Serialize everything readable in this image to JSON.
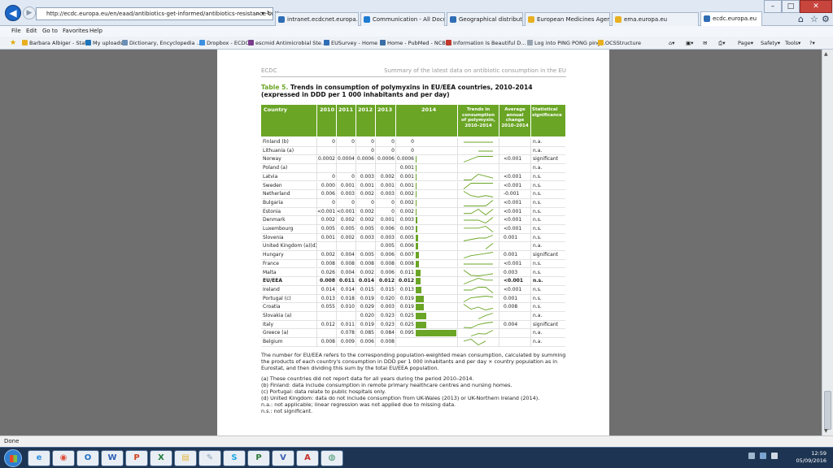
{
  "browser": {
    "address": "http://ecdc.europa.eu/en/eaad/antibiotics-get-informed/antibiotics-resistance-consum",
    "address_domain": "ecdc.europa.eu",
    "tabs": [
      {
        "label": "intranet.ecdcnet.europa.eu",
        "color": "#2f6db5"
      },
      {
        "label": "Communication - All Docum...",
        "color": "#1d7bd1"
      },
      {
        "label": "Geographical distribution of a...",
        "color": "#2f6db5"
      },
      {
        "label": "European Medicines Agency ...",
        "color": "#e8b020"
      },
      {
        "label": "ema.europa.eu",
        "color": "#e8b020"
      },
      {
        "label": "ecdc.europa.eu",
        "color": "#2f6db5"
      }
    ],
    "menu": [
      "File",
      "Edit",
      "Go to",
      "Favorites",
      "Help"
    ],
    "favorites": [
      "Barbara Albiger - Stats",
      "My uploads",
      "Dictionary, Encyclopedia ...",
      "Dropbox - ECDC",
      "escmid Antimicrobial Ste...",
      "EUSurvey - Home",
      "Home - PubMed - NCBI",
      "Information Is Beautiful D...",
      "Log into PING PONG ping...",
      "OCSStructure"
    ],
    "command_items": [
      "Page",
      "Safety",
      "Tools"
    ],
    "status": "Done"
  },
  "document": {
    "running_head_left": "ECDC",
    "running_head_right": "Summary of the latest data on antibiotic consumption in the EU",
    "table_label": "Table 5.",
    "table_title": "Trends in consumption of polymyxins in EU/EEA countries, 2010–2014 (expressed in DDD per 1 000 inhabitants and per day)",
    "headers": {
      "country": "Country",
      "y2010": "2010",
      "y2011": "2011",
      "y2012": "2012",
      "y2013": "2013",
      "y2014": "2014",
      "trends": "Trends in consumption of polymyxin, 2010–2014",
      "avg": "Average annual change 2010–2014",
      "stat": "Statistical significance"
    },
    "bar_max": 0.095,
    "rows": [
      {
        "country": "Finland (b)",
        "v": [
          "0",
          "0",
          "0",
          "0",
          "0"
        ],
        "val2014": 0,
        "series": [
          0,
          0,
          0,
          0,
          0
        ],
        "avg": "",
        "sig": "n.a.",
        "bold": false
      },
      {
        "country": "Lithuania (a)",
        "v": [
          "",
          "",
          "0",
          "0",
          "0"
        ],
        "val2014": 0,
        "series": [
          null,
          null,
          0,
          0,
          0
        ],
        "avg": "",
        "sig": "n.a.",
        "bold": false
      },
      {
        "country": "Norway",
        "v": [
          "0.0002",
          "0.0004",
          "0.0006",
          "0.0006",
          "0.0006"
        ],
        "val2014": 0.0006,
        "series": [
          0.0002,
          0.0004,
          0.0006,
          0.0006,
          0.0006
        ],
        "avg": "<0.001",
        "sig": "significant",
        "bold": false
      },
      {
        "country": "Poland (a)",
        "v": [
          "",
          "",
          "",
          "",
          "0.001"
        ],
        "val2014": 0.001,
        "series": [
          null,
          null,
          null,
          null,
          0.001
        ],
        "avg": "",
        "sig": "n.a.",
        "bold": false
      },
      {
        "country": "Latvia",
        "v": [
          "0",
          "0",
          "0.003",
          "0.002",
          "0.001"
        ],
        "val2014": 0.001,
        "series": [
          0,
          0,
          0.003,
          0.002,
          0.001
        ],
        "avg": "<0.001",
        "sig": "n.s.",
        "bold": false
      },
      {
        "country": "Sweden",
        "v": [
          "0.000",
          "0.001",
          "0.001",
          "0.001",
          "0.001"
        ],
        "val2014": 0.001,
        "series": [
          0,
          0.001,
          0.001,
          0.001,
          0.001
        ],
        "avg": "<0.001",
        "sig": "n.s.",
        "bold": false
      },
      {
        "country": "Netherland",
        "v": [
          "0.006",
          "0.003",
          "0.002",
          "0.003",
          "0.002"
        ],
        "val2014": 0.002,
        "series": [
          0.006,
          0.003,
          0.002,
          0.003,
          0.002
        ],
        "avg": "-0.001",
        "sig": "n.s.",
        "bold": false
      },
      {
        "country": "Bulgaria",
        "v": [
          "0",
          "0",
          "0",
          "0",
          "0.002"
        ],
        "val2014": 0.002,
        "series": [
          0,
          0,
          0,
          0,
          0.002
        ],
        "avg": "<0.001",
        "sig": "n.s.",
        "bold": false
      },
      {
        "country": "Estonia",
        "v": [
          "<0.001",
          "<0.001",
          "0.002",
          "0",
          "0.002"
        ],
        "val2014": 0.002,
        "series": [
          0.0005,
          0.0005,
          0.002,
          0,
          0.002
        ],
        "avg": "<0.001",
        "sig": "n.s.",
        "bold": false
      },
      {
        "country": "Denmark",
        "v": [
          "0.002",
          "0.002",
          "0.002",
          "0.001",
          "0.003"
        ],
        "val2014": 0.003,
        "series": [
          0.002,
          0.002,
          0.002,
          0.001,
          0.003
        ],
        "avg": "<0.001",
        "sig": "n.s.",
        "bold": false
      },
      {
        "country": "Luxembourg",
        "v": [
          "0.005",
          "0.005",
          "0.005",
          "0.006",
          "0.003"
        ],
        "val2014": 0.003,
        "series": [
          0.005,
          0.005,
          0.005,
          0.006,
          0.003
        ],
        "avg": "<0.001",
        "sig": "n.s.",
        "bold": false
      },
      {
        "country": "Slovenia",
        "v": [
          "0.001",
          "0.002",
          "0.003",
          "0.003",
          "0.005"
        ],
        "val2014": 0.005,
        "series": [
          0.001,
          0.002,
          0.003,
          0.003,
          0.005
        ],
        "avg": "0.001",
        "sig": "n.s.",
        "bold": false
      },
      {
        "country": "United Kingdom (a)(d)",
        "v": [
          "",
          "",
          "",
          "0.005",
          "0.006"
        ],
        "val2014": 0.006,
        "series": [
          null,
          null,
          null,
          0.005,
          0.006
        ],
        "avg": "",
        "sig": "n.a.",
        "bold": false
      },
      {
        "country": "Hungary",
        "v": [
          "0.002",
          "0.004",
          "0.005",
          "0.006",
          "0.007"
        ],
        "val2014": 0.007,
        "series": [
          0.002,
          0.004,
          0.005,
          0.006,
          0.007
        ],
        "avg": "0.001",
        "sig": "significant",
        "bold": false
      },
      {
        "country": "France",
        "v": [
          "0.008",
          "0.008",
          "0.008",
          "0.008",
          "0.008"
        ],
        "val2014": 0.008,
        "series": [
          0.008,
          0.008,
          0.008,
          0.008,
          0.008
        ],
        "avg": "<0.001",
        "sig": "n.s.",
        "bold": false
      },
      {
        "country": "Malta",
        "v": [
          "0.026",
          "0.004",
          "0.002",
          "0.006",
          "0.011"
        ],
        "val2014": 0.011,
        "series": [
          0.026,
          0.004,
          0.002,
          0.006,
          0.011
        ],
        "avg": "0.003",
        "sig": "n.s.",
        "bold": false
      },
      {
        "country": "EU/EEA",
        "v": [
          "0.008",
          "0.011",
          "0.014",
          "0.012",
          "0.012"
        ],
        "val2014": 0.012,
        "series": [
          0.008,
          0.011,
          0.014,
          0.012,
          0.012
        ],
        "avg": "<0.001",
        "sig": "n.s.",
        "bold": true
      },
      {
        "country": "Ireland",
        "v": [
          "0.014",
          "0.014",
          "0.015",
          "0.015",
          "0.013"
        ],
        "val2014": 0.013,
        "series": [
          0.014,
          0.014,
          0.015,
          0.015,
          0.013
        ],
        "avg": "<0.001",
        "sig": "n.s.",
        "bold": false
      },
      {
        "country": "Portugal (c)",
        "v": [
          "0.013",
          "0.018",
          "0.019",
          "0.020",
          "0.019"
        ],
        "val2014": 0.019,
        "series": [
          0.013,
          0.018,
          0.019,
          0.02,
          0.019
        ],
        "avg": "0.001",
        "sig": "n.s.",
        "bold": false
      },
      {
        "country": "Croatia",
        "v": [
          "0.055",
          "0.010",
          "0.029",
          "0.003",
          "0.019"
        ],
        "val2014": 0.019,
        "series": [
          0.055,
          0.01,
          0.029,
          0.003,
          0.019
        ],
        "avg": "0.008",
        "sig": "n.s.",
        "bold": false
      },
      {
        "country": "Slovakia (a)",
        "v": [
          "",
          "",
          "0.020",
          "0.023",
          "0.025"
        ],
        "val2014": 0.025,
        "series": [
          null,
          null,
          0.02,
          0.023,
          0.025
        ],
        "avg": "",
        "sig": "n.a.",
        "bold": false
      },
      {
        "country": "Italy",
        "v": [
          "0.012",
          "0.011",
          "0.019",
          "0.023",
          "0.025"
        ],
        "val2014": 0.025,
        "series": [
          0.012,
          0.011,
          0.019,
          0.023,
          0.025
        ],
        "avg": "0.004",
        "sig": "significant",
        "bold": false
      },
      {
        "country": "Greece (a)",
        "v": [
          "",
          "0.078",
          "0.085",
          "0.084",
          "0.095"
        ],
        "val2014": 0.095,
        "series": [
          null,
          0.078,
          0.085,
          0.084,
          0.095
        ],
        "avg": "",
        "sig": "n.a.",
        "bold": false
      },
      {
        "country": "Belgium",
        "v": [
          "0.008",
          "0.009",
          "0.006",
          "0.008",
          ""
        ],
        "val2014": 0,
        "series": [
          0.008,
          0.009,
          0.006,
          0.008,
          null
        ],
        "avg": "",
        "sig": "n.a.",
        "bold": false
      }
    ],
    "notes_main": "The number for EU/EEA refers to the corresponding population-weighted mean consumption, calculated by summing the products of each country's consumption in DDD per 1 000 inhabitants and per day × country population as in Eurostat, and then dividing this sum by the total EU/EEA population.",
    "notes": [
      "(a) These countries did not report data for all years during the period 2010–2014.",
      "(b) Finland: data include consumption in remote primary healthcare centres and nursing homes.",
      "(c) Portugal: data relate to public hospitals only.",
      "(d) United Kingdom: data do not include consumption from UK-Wales (2013) or UK-Northern Ireland (2014).",
      "n.a.: not applicable; linear regression was not applied due to missing data.",
      "n.s.: not significant."
    ]
  },
  "taskbar": {
    "apps": [
      {
        "name": "ie",
        "glyph": "e",
        "color": "#2f8fe0"
      },
      {
        "name": "chrome",
        "glyph": "◉",
        "color": "#dd4b39"
      },
      {
        "name": "outlook",
        "glyph": "O",
        "color": "#1f6fc4"
      },
      {
        "name": "word",
        "glyph": "W",
        "color": "#2b5fb4"
      },
      {
        "name": "powerpoint",
        "glyph": "P",
        "color": "#d04525"
      },
      {
        "name": "excel",
        "glyph": "X",
        "color": "#1e7a3c"
      },
      {
        "name": "explorer",
        "glyph": "▤",
        "color": "#e4b63a"
      },
      {
        "name": "notepad",
        "glyph": "✎",
        "color": "#8aa0b8"
      },
      {
        "name": "skype",
        "glyph": "S",
        "color": "#1aa7e5"
      },
      {
        "name": "project",
        "glyph": "P",
        "color": "#2f7a3a"
      },
      {
        "name": "visio",
        "glyph": "V",
        "color": "#3a5fb0"
      },
      {
        "name": "acrobat",
        "glyph": "A",
        "color": "#c8302a"
      },
      {
        "name": "network",
        "glyph": "◍",
        "color": "#3f8f6a"
      }
    ],
    "time": "12:59",
    "date": "05/09/2016"
  },
  "colors": {
    "accent_green": "#6aa525"
  }
}
